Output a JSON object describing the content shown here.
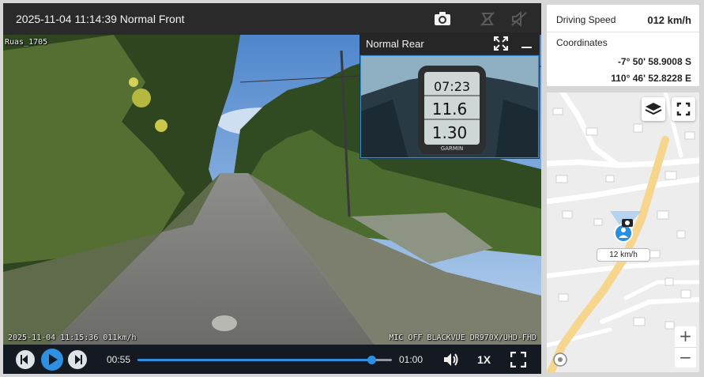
{
  "video": {
    "title": "2025-11-04 11:14:39 Normal Front",
    "overlay_top_left": "Ruas_1705",
    "overlay_bottom_left": "2025-11-04 11:15:36 011km/h",
    "overlay_bottom_right": "MIC OFF BLACKVUE DR970X/UHD-FHD",
    "header_icons": [
      "camera-icon",
      "event-icon",
      "mute-icon"
    ]
  },
  "rear": {
    "title": "Normal Rear",
    "device_readouts": [
      "07:23",
      "11.6",
      "1.30"
    ],
    "device_brand": "GARMIN"
  },
  "controls": {
    "current_time": "00:55",
    "total_time": "01:00",
    "progress": 0.92,
    "playback_rate": "1X"
  },
  "info": {
    "speed_label": "Driving Speed",
    "speed_value": "012 km/h",
    "coordinates_label": "Coordinates",
    "latitude": "-7° 50' 58.9008 S",
    "longitude": "110° 46' 52.8228 E"
  },
  "map": {
    "speed_tag": "12 km/h",
    "zoom_in": "+",
    "zoom_out": "−",
    "colors": {
      "road_main": "#f6d58d",
      "road_minor": "#ffffff",
      "background": "#ededed",
      "marker": "#2a8fe0"
    }
  }
}
